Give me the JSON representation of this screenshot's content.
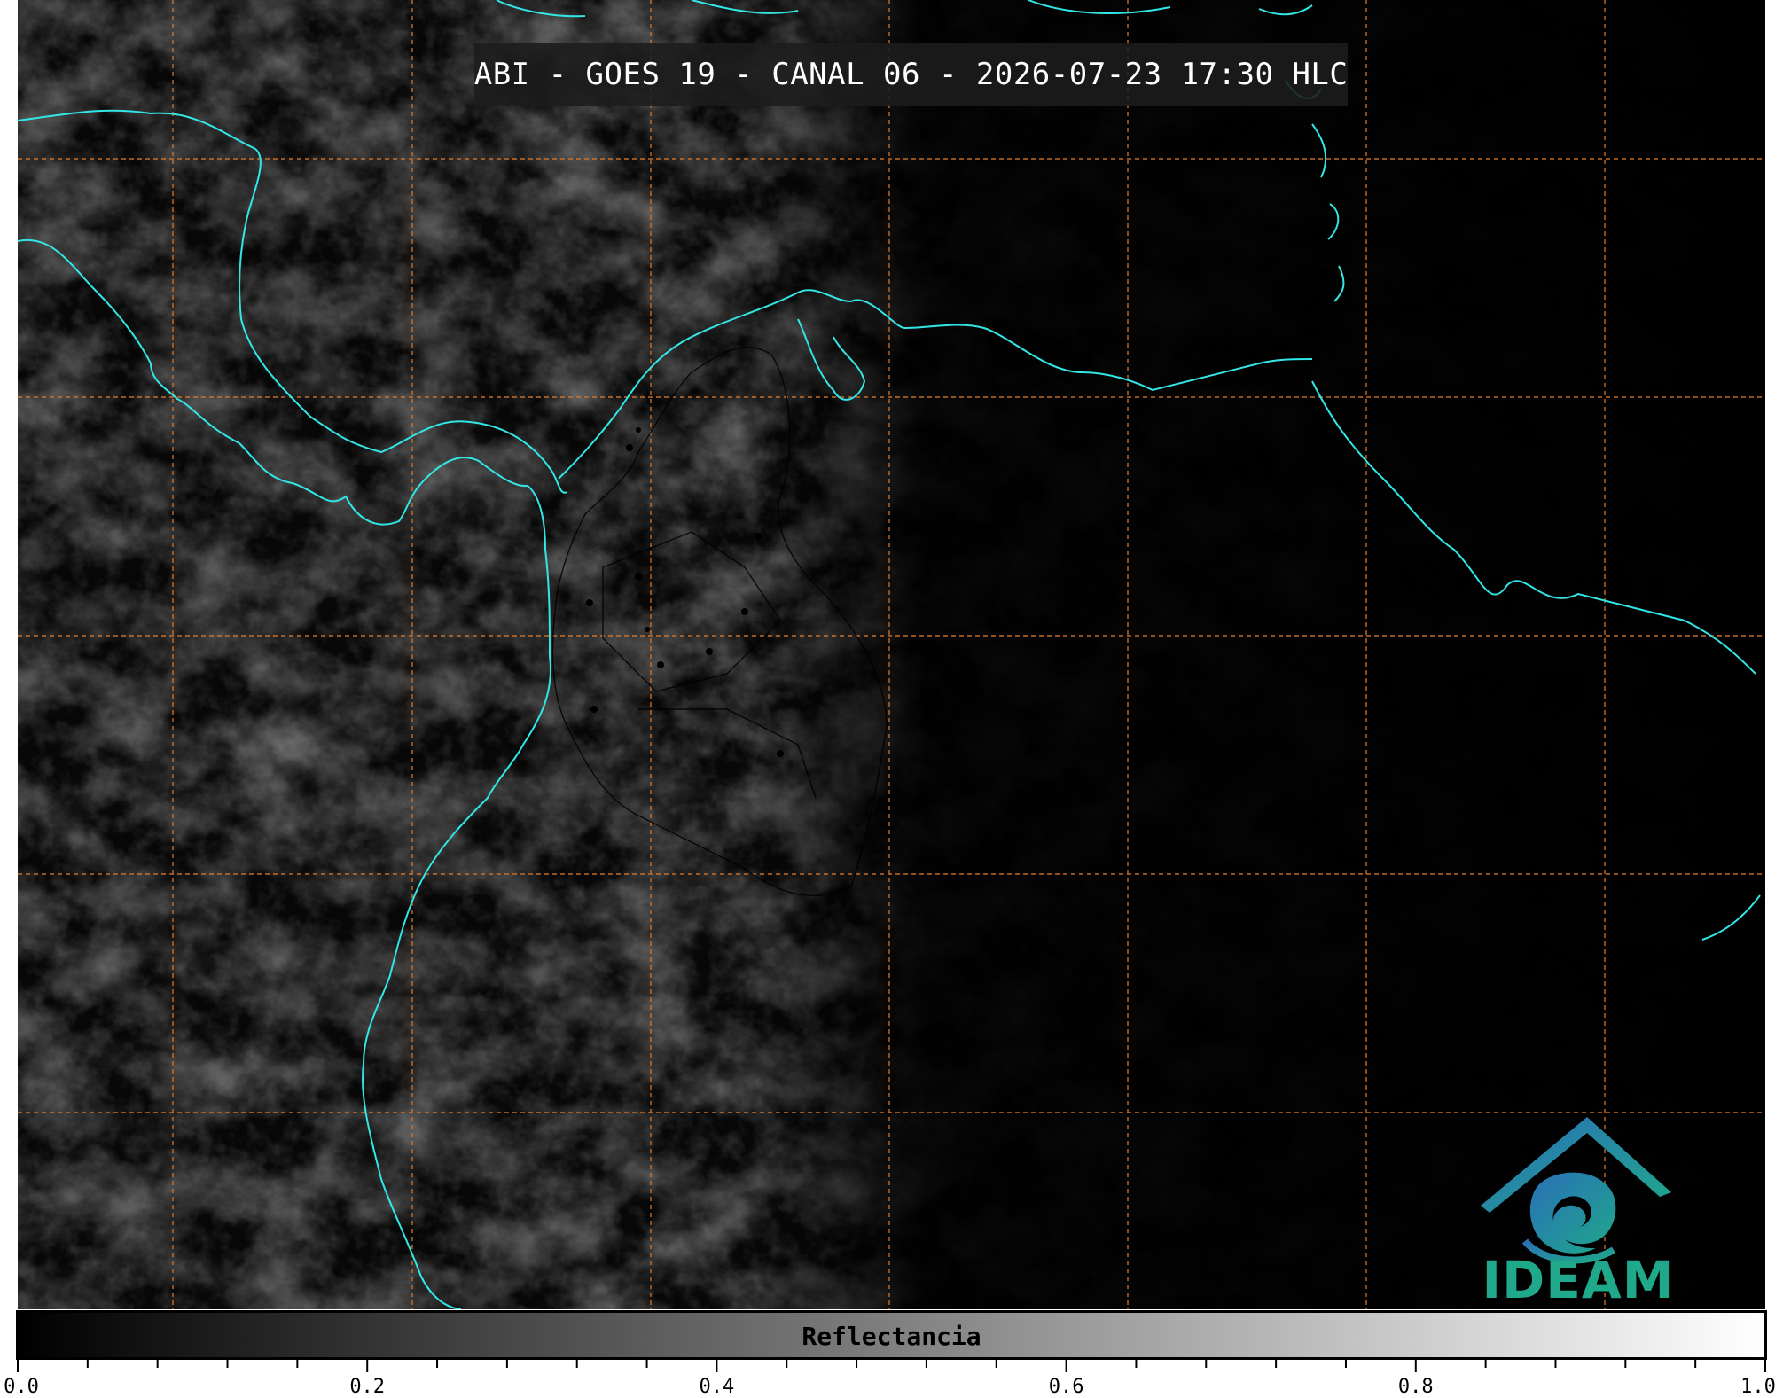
{
  "title": "ABI - GOES 19 - CANAL 06 - 2026-07-23 17:30 HLC",
  "colorbar": {
    "label": "Reflectancia",
    "range": [
      0.0,
      1.0
    ],
    "major_ticks": [
      "0.0",
      "0.2",
      "0.4",
      "0.6",
      "0.8",
      "1.0"
    ],
    "minor_ticks_per_major": 4,
    "colormap": "grayscale black-to-white"
  },
  "map": {
    "coastline_color": "#33e6e6",
    "grid_color": "#d9772a",
    "grid_style": "dashed",
    "border_color": "#000000",
    "imagery": "grayscale satellite reflectance"
  },
  "logo": {
    "text": "IDEAM",
    "icon": "ideam-swirl-mountain-icon",
    "colors": [
      "#2a6fb8",
      "#1fa88a"
    ]
  }
}
